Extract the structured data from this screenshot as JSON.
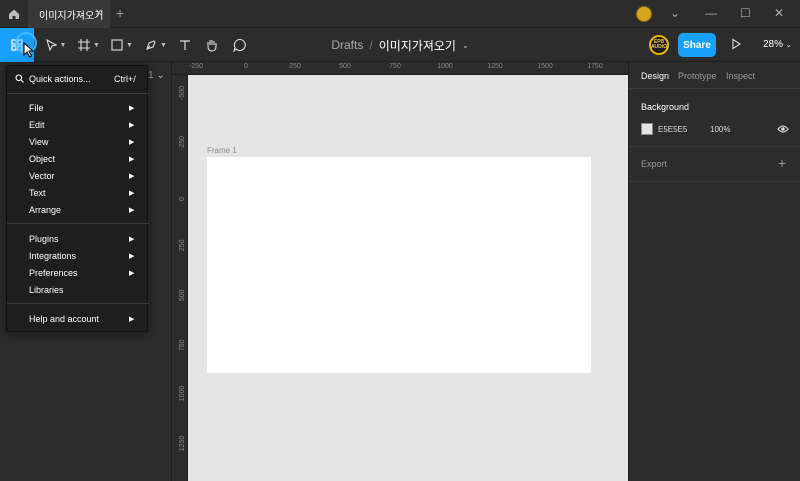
{
  "titlebar": {
    "tab_title": "이미지가져오기",
    "close_glyph": "✕",
    "new_tab_glyph": "+",
    "window_controls": [
      "⌄",
      "—",
      "☐",
      "✕"
    ]
  },
  "toolbar": {
    "breadcrumb_drafts": "Drafts",
    "breadcrumb_sep": "/",
    "file_name": "이미지가져오기",
    "file_caret": "⌄",
    "share_label": "Share",
    "zoom_label": "28%",
    "avatar_text": "EPB AUDIO"
  },
  "page_indicator": "1 ⌄",
  "rulers": {
    "top": [
      "-250",
      "0",
      "250",
      "500",
      "750",
      "1000",
      "1250",
      "1500",
      "1750"
    ],
    "left": [
      "-500",
      "-250",
      "0",
      "250",
      "500",
      "750",
      "1000",
      "1250"
    ]
  },
  "canvas": {
    "frame_label": "Frame 1",
    "help_label": "?",
    "background": "#E5E5E5"
  },
  "right_panel": {
    "tabs": [
      "Design",
      "Prototype",
      "Inspect"
    ],
    "background_label": "Background",
    "background_hex": "E5E5E5",
    "background_opacity": "100%",
    "export_label": "Export",
    "plus_glyph": "+"
  },
  "menu": {
    "quick_actions": "Quick actions...",
    "quick_shortcut": "Ctrl+/",
    "group1": [
      "File",
      "Edit",
      "View",
      "Object",
      "Vector",
      "Text",
      "Arrange"
    ],
    "group2": [
      "Plugins",
      "Integrations",
      "Preferences",
      "Libraries"
    ],
    "group3": [
      "Help and account"
    ],
    "submenu_arrow": "▶"
  },
  "colors": {
    "accent": "#18A0FB",
    "toolbar_bg": "#2C2C2C",
    "menu_bg": "#1E1E1E"
  }
}
